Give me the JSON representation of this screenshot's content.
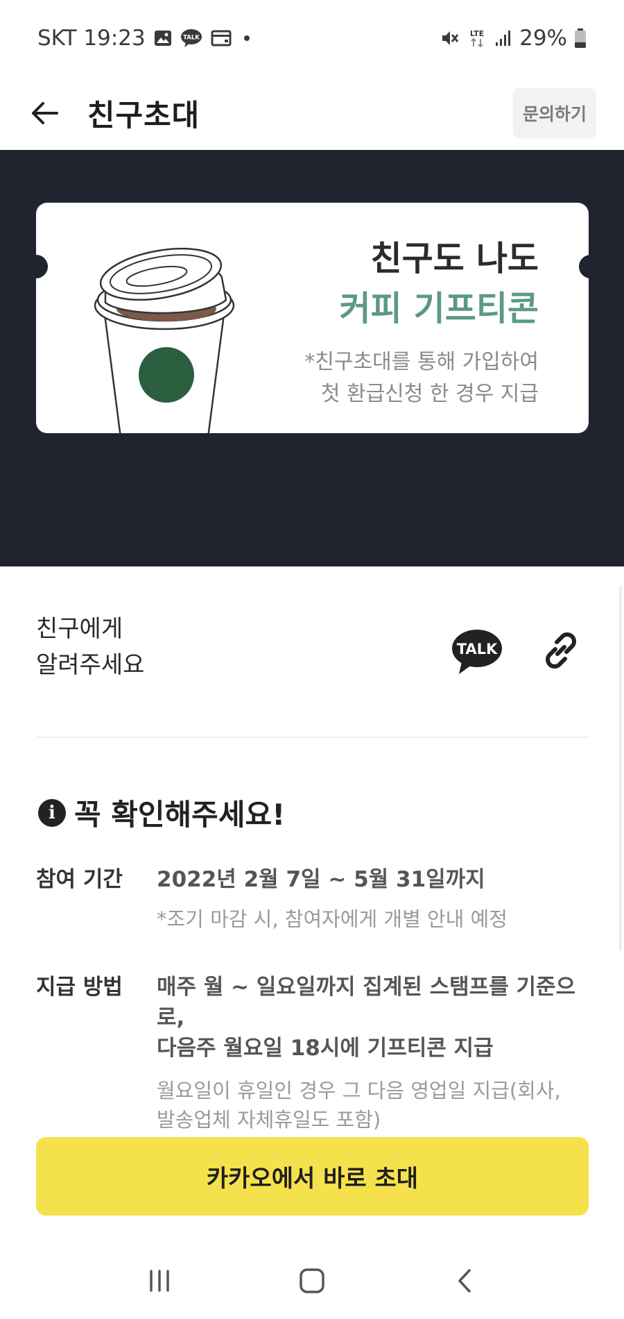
{
  "status_bar": {
    "carrier_time": "SKT 19:23",
    "network": "LTE",
    "battery": "29%"
  },
  "header": {
    "title": "친구초대",
    "inquiry_label": "문의하기"
  },
  "banner": {
    "title": "친구도 나도",
    "subtitle": "커피 기프티콘",
    "note_line1": "*친구초대를 통해 가입하여",
    "note_line2": "첫 환급신청 한 경우 지급",
    "accent_color": "#5b9a81",
    "background_color": "#20242e"
  },
  "share": {
    "label_line1": "친구에게",
    "label_line2": "알려주세요",
    "talk_label": "TALK"
  },
  "notice": {
    "title": "꼭 확인해주세요!",
    "rows": [
      {
        "label": "참여 기간",
        "main": "2022년 2월 7일 ~ 5월 31일까지",
        "sub": "*조기 마감 시, 참여자에게 개별 안내 예정"
      },
      {
        "label": "지급 방법",
        "main_line1": "매주 월 ~ 일요일까지 집계된 스탬프를 기준으로,",
        "main_line2": "다음주 월요일 18시에 기프티콘 지급",
        "sub_line1": "월요일이 휴일인 경우 그 다음 영업일 지급(회사,",
        "sub_line2": "발송업체 자체휴일도 포함)"
      }
    ]
  },
  "cta": {
    "label": "카카오에서 바로 초대",
    "color": "#f5e14b"
  },
  "navbar": {
    "icons": [
      "recent-apps-icon",
      "home-icon",
      "back-icon"
    ]
  }
}
